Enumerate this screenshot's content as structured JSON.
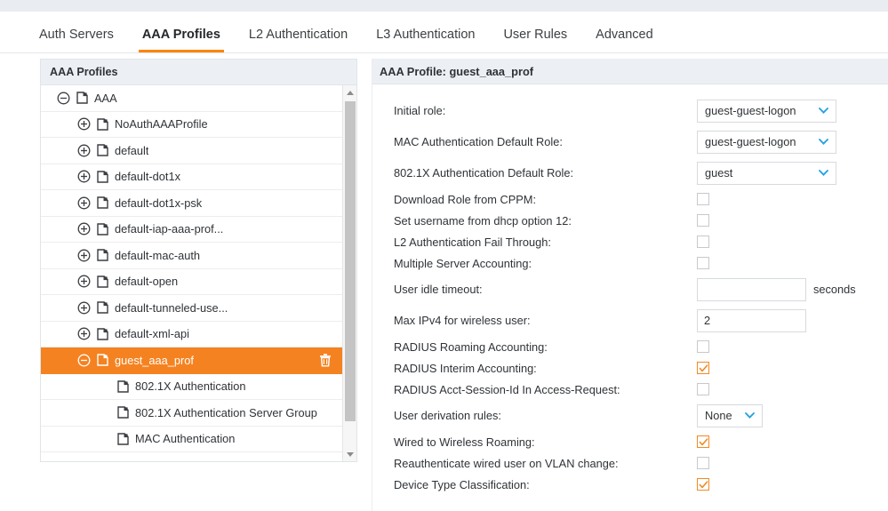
{
  "tabs": [
    {
      "label": "Auth Servers",
      "active": false
    },
    {
      "label": "AAA Profiles",
      "active": true
    },
    {
      "label": "L2 Authentication",
      "active": false
    },
    {
      "label": "L3 Authentication",
      "active": false
    },
    {
      "label": "User Rules",
      "active": false
    },
    {
      "label": "Advanced",
      "active": false
    }
  ],
  "tree": {
    "header": "AAA Profiles",
    "rows": [
      {
        "label": "AAA",
        "indent": 0,
        "toggle": "minus",
        "selected": false,
        "trash": false
      },
      {
        "label": "NoAuthAAAProfile",
        "indent": 1,
        "toggle": "plus",
        "selected": false,
        "trash": false
      },
      {
        "label": "default",
        "indent": 1,
        "toggle": "plus",
        "selected": false,
        "trash": false
      },
      {
        "label": "default-dot1x",
        "indent": 1,
        "toggle": "plus",
        "selected": false,
        "trash": false
      },
      {
        "label": "default-dot1x-psk",
        "indent": 1,
        "toggle": "plus",
        "selected": false,
        "trash": false
      },
      {
        "label": "default-iap-aaa-prof...",
        "indent": 1,
        "toggle": "plus",
        "selected": false,
        "trash": false
      },
      {
        "label": "default-mac-auth",
        "indent": 1,
        "toggle": "plus",
        "selected": false,
        "trash": false
      },
      {
        "label": "default-open",
        "indent": 1,
        "toggle": "plus",
        "selected": false,
        "trash": false
      },
      {
        "label": "default-tunneled-use...",
        "indent": 1,
        "toggle": "plus",
        "selected": false,
        "trash": false
      },
      {
        "label": "default-xml-api",
        "indent": 1,
        "toggle": "plus",
        "selected": false,
        "trash": false
      },
      {
        "label": "guest_aaa_prof",
        "indent": 1,
        "toggle": "minus",
        "selected": true,
        "trash": true
      },
      {
        "label": "802.1X Authentication",
        "indent": 2,
        "toggle": "none",
        "selected": false,
        "trash": false
      },
      {
        "label": "802.1X Authentication Server Group",
        "indent": 2,
        "toggle": "none",
        "selected": false,
        "trash": false
      },
      {
        "label": "MAC Authentication",
        "indent": 2,
        "toggle": "none",
        "selected": false,
        "trash": false
      }
    ]
  },
  "detail": {
    "header": "AAA Profile: guest_aaa_prof",
    "fields": [
      {
        "label": "Initial role:",
        "type": "select",
        "value": "guest-guest-logon"
      },
      {
        "label": "MAC Authentication Default Role:",
        "type": "select",
        "value": "guest-guest-logon"
      },
      {
        "label": "802.1X Authentication Default Role:",
        "type": "select",
        "value": "guest"
      },
      {
        "label": "Download Role from CPPM:",
        "type": "checkbox",
        "checked": false
      },
      {
        "label": "Set username from dhcp option 12:",
        "type": "checkbox",
        "checked": false
      },
      {
        "label": "L2 Authentication Fail Through:",
        "type": "checkbox",
        "checked": false
      },
      {
        "label": "Multiple Server Accounting:",
        "type": "checkbox",
        "checked": false
      },
      {
        "label": "User idle timeout:",
        "type": "text",
        "value": "",
        "suffix": "seconds"
      },
      {
        "label": "Max IPv4 for wireless user:",
        "type": "text",
        "value": "2"
      },
      {
        "label": "RADIUS Roaming Accounting:",
        "type": "checkbox",
        "checked": false
      },
      {
        "label": "RADIUS Interim Accounting:",
        "type": "checkbox",
        "checked": true
      },
      {
        "label": "RADIUS Acct-Session-Id In Access-Request:",
        "type": "checkbox",
        "checked": false
      },
      {
        "label": "User derivation rules:",
        "type": "select",
        "value": "None",
        "narrow": true
      },
      {
        "label": "Wired to Wireless Roaming:",
        "type": "checkbox",
        "checked": true
      },
      {
        "label": "Reauthenticate wired user on VLAN change:",
        "type": "checkbox",
        "checked": false
      },
      {
        "label": "Device Type Classification:",
        "type": "checkbox",
        "checked": true
      }
    ]
  },
  "icons": {
    "profile": "profile-doc-icon",
    "expand": "plus-circle-icon",
    "collapse": "minus-circle-icon",
    "delete": "trash-icon",
    "dropdown": "chevron-down-icon",
    "scroll_up": "scroll-up-arrow-icon",
    "scroll_down": "scroll-down-arrow-icon"
  },
  "colors": {
    "accent": "#ff8300",
    "selected_row": "#f58220",
    "checkbox_checked": "#f08a24",
    "chevron": "#29a3e3",
    "panel_header": "#eceff3"
  }
}
